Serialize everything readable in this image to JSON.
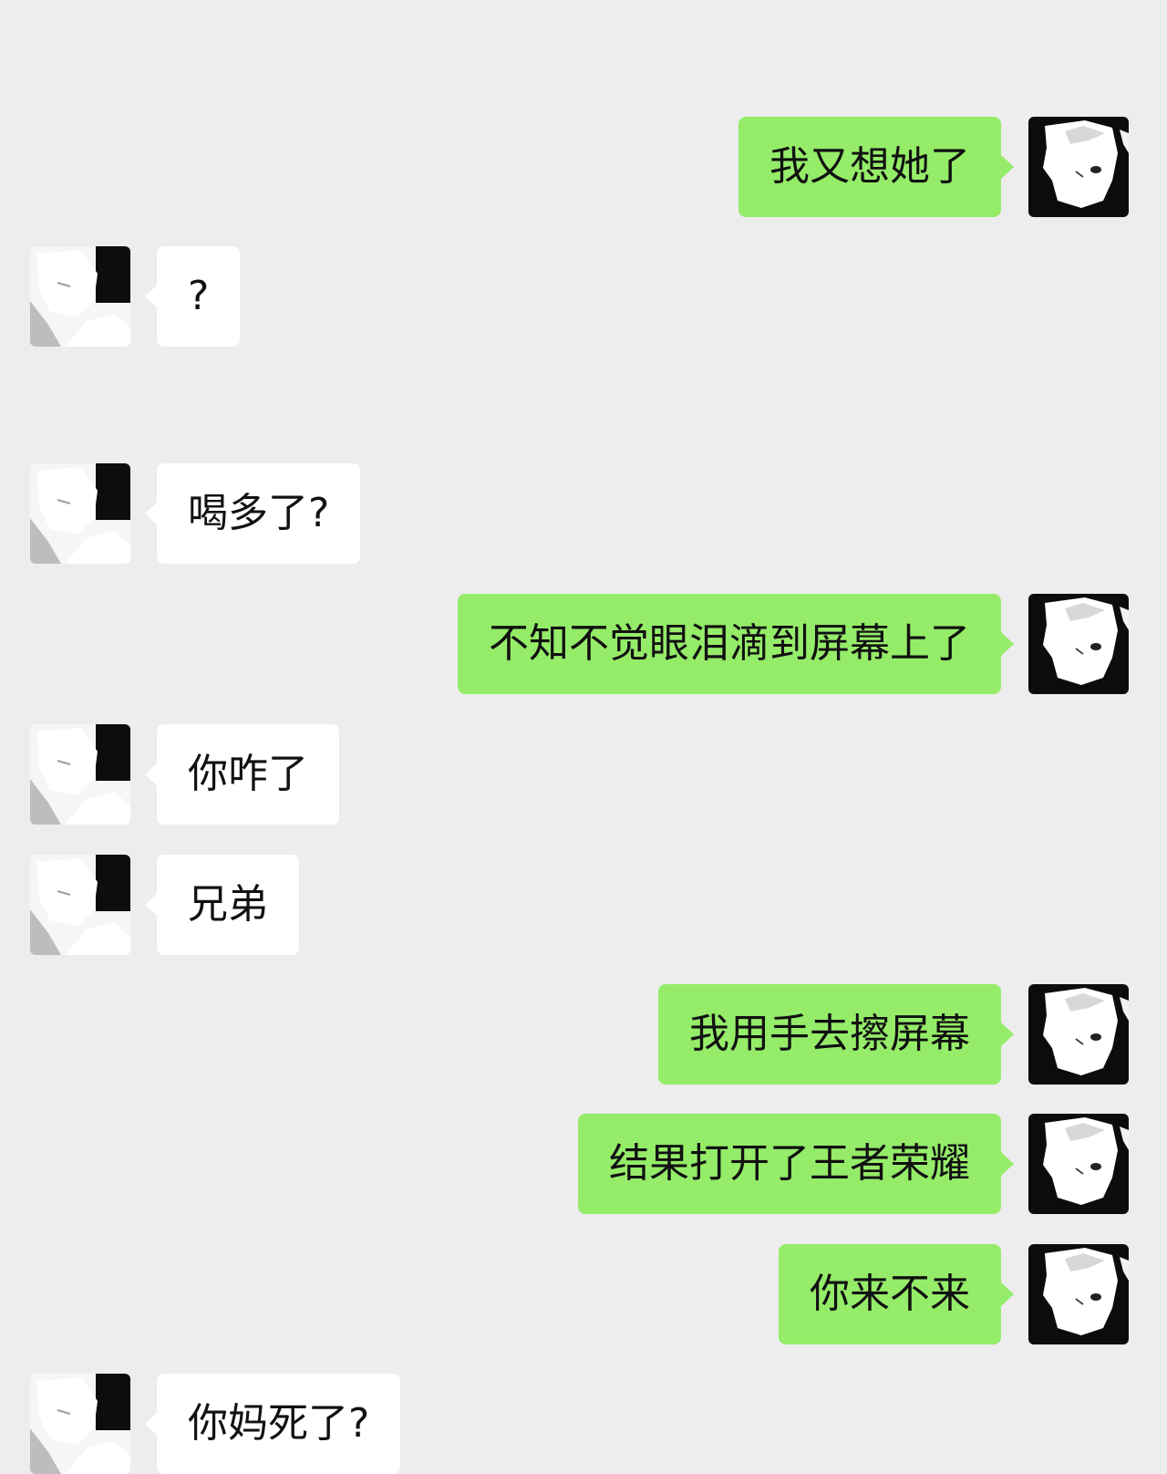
{
  "colors": {
    "background": "#ededed",
    "sent_bubble": "#95ec69",
    "received_bubble": "#ffffff"
  },
  "messages": [
    {
      "sender": "me",
      "text": "我又想她了"
    },
    {
      "sender": "them",
      "text": "?"
    },
    {
      "sender": "them",
      "text": "喝多了?"
    },
    {
      "sender": "me",
      "text": "不知不觉眼泪滴到屏幕上了"
    },
    {
      "sender": "them",
      "text": "你咋了"
    },
    {
      "sender": "them",
      "text": "兄弟"
    },
    {
      "sender": "me",
      "text": "我用手去擦屏幕"
    },
    {
      "sender": "me",
      "text": "结果打开了王者荣耀"
    },
    {
      "sender": "me",
      "text": "你来不来"
    },
    {
      "sender": "them",
      "text": "你妈死了?"
    }
  ]
}
